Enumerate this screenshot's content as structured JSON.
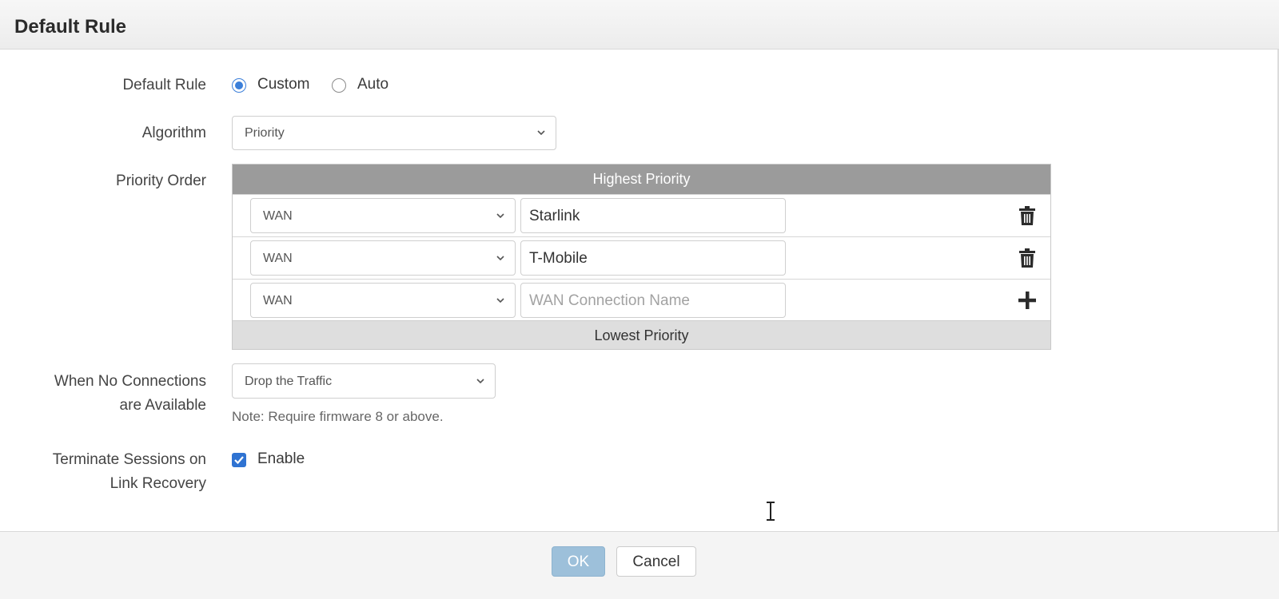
{
  "dialog": {
    "title": "Default Rule"
  },
  "form": {
    "default_rule": {
      "label": "Default Rule",
      "options": [
        {
          "label": "Custom",
          "checked": true
        },
        {
          "label": "Auto",
          "checked": false
        }
      ]
    },
    "algorithm": {
      "label": "Algorithm",
      "value": "Priority"
    },
    "priority_order": {
      "label": "Priority Order",
      "header": "Highest Priority",
      "footer": "Lowest Priority",
      "rows": [
        {
          "type": "WAN",
          "connection": "Starlink",
          "action_icon": "trash-icon"
        },
        {
          "type": "WAN",
          "connection": "T-Mobile",
          "action_icon": "trash-icon"
        },
        {
          "type": "WAN",
          "connection": "",
          "placeholder": "WAN Connection Name",
          "action_icon": "plus-icon"
        }
      ]
    },
    "no_connections": {
      "label_line1": "When No Connections",
      "label_line2": "are Available",
      "value": "Drop the Traffic",
      "note": "Note: Require firmware 8 or above."
    },
    "terminate_sessions": {
      "label_line1": "Terminate Sessions on",
      "label_line2": "Link Recovery",
      "checkbox_label": "Enable",
      "checked": true
    }
  },
  "footer": {
    "ok_label": "OK",
    "cancel_label": "Cancel"
  },
  "colors": {
    "accent": "#2f73d2",
    "header_band": "#9b9b9b",
    "footer_band": "#dedede",
    "ok_button": "#9dc0da"
  }
}
